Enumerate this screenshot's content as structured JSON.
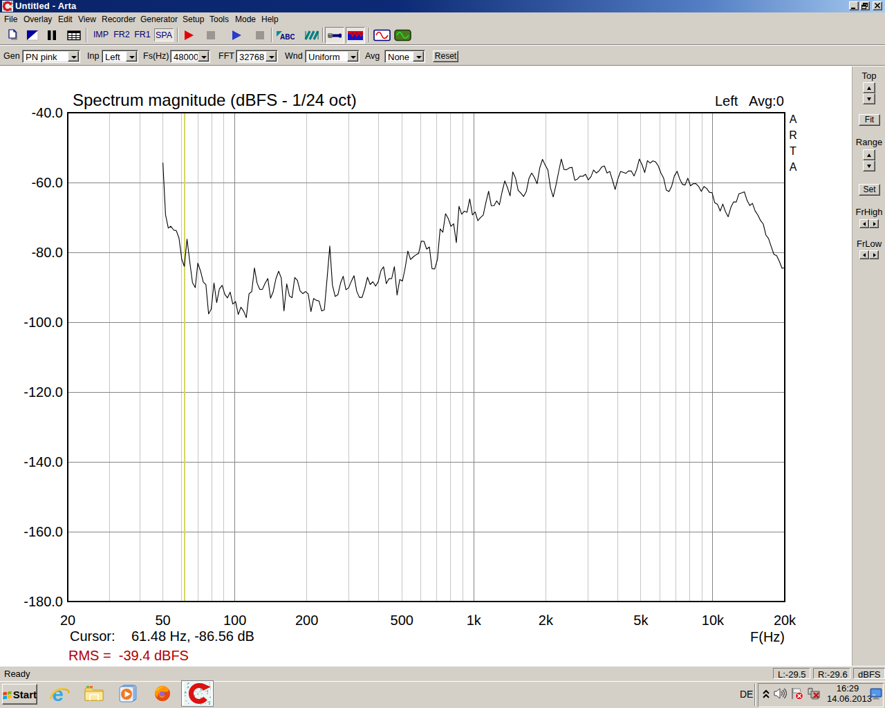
{
  "window": {
    "title": "Untitled - Arta"
  },
  "titlebar_buttons": {
    "minimize": "minimize",
    "restore": "restore",
    "close": "close"
  },
  "menu": {
    "items": [
      "File",
      "Overlay",
      "Edit",
      "View",
      "Recorder",
      "Generator",
      "Setup",
      "Tools",
      "Mode",
      "Help"
    ]
  },
  "toolbar": {
    "mode_buttons": [
      {
        "label": "IMP",
        "active": false
      },
      {
        "label": "FR2",
        "active": false
      },
      {
        "label": "FR1",
        "active": false
      },
      {
        "label": "SPA",
        "active": true
      }
    ]
  },
  "controls": {
    "gen": {
      "label": "Gen",
      "value": "PN pink"
    },
    "inp": {
      "label": "Inp",
      "value": "Left"
    },
    "fs": {
      "label": "Fs(Hz)",
      "value": "48000"
    },
    "fft": {
      "label": "FFT",
      "value": "32768"
    },
    "wnd": {
      "label": "Wnd",
      "value": "Uniform"
    },
    "avg": {
      "label": "Avg",
      "value": "None"
    },
    "reset_label": "Reset"
  },
  "side_panel": {
    "top_label": "Top",
    "fit_label": "Fit",
    "range_label": "Range",
    "set_label": "Set",
    "frhigh_label": "FrHigh",
    "frlow_label": "FrLow"
  },
  "chart_data": {
    "type": "line",
    "title": "Spectrum magnitude (dBFS - 1/24 oct)",
    "channel_label": "Left",
    "avg_label": "Avg:0",
    "watermark": "ARTA",
    "xlabel": "F(Hz)",
    "x_scale": "log",
    "xlim": [
      20,
      20000
    ],
    "ylim": [
      -180,
      -40
    ],
    "x_ticks": [
      {
        "value": 20,
        "label": "20"
      },
      {
        "value": 50,
        "label": "50"
      },
      {
        "value": 100,
        "label": "100"
      },
      {
        "value": 200,
        "label": "200"
      },
      {
        "value": 500,
        "label": "500"
      },
      {
        "value": 1000,
        "label": "1k"
      },
      {
        "value": 2000,
        "label": "2k"
      },
      {
        "value": 5000,
        "label": "5k"
      },
      {
        "value": 10000,
        "label": "10k"
      },
      {
        "value": 20000,
        "label": "20k"
      }
    ],
    "y_ticks": [
      {
        "value": -40,
        "label": "-40.0"
      },
      {
        "value": -60,
        "label": "-60.0"
      },
      {
        "value": -80,
        "label": "-80.0"
      },
      {
        "value": -100,
        "label": "-100.0"
      },
      {
        "value": -120,
        "label": "-120.0"
      },
      {
        "value": -140,
        "label": "-140.0"
      },
      {
        "value": -160,
        "label": "-160.0"
      },
      {
        "value": -180,
        "label": "-180.0"
      }
    ],
    "grid": {
      "minor_color": "#c6c6c6",
      "major_color": "#848484",
      "decades": [
        100,
        1000,
        10000
      ]
    },
    "cursor": {
      "freq_hz": 61.48,
      "db": -86.56,
      "label": "Cursor:",
      "value": "61.48 Hz, -86.56 dB",
      "color": "#d6d65e"
    },
    "rms_label": "RMS =  -39.4 dBFS",
    "rms_color": "#b00000",
    "series": [
      {
        "name": "Left",
        "color": "#000000",
        "points": [
          [
            50.0,
            -54.3
          ],
          [
            51.3,
            -69.18
          ],
          [
            52.7,
            -73.05
          ],
          [
            54.0,
            -72.52
          ],
          [
            55.5,
            -73.62
          ],
          [
            56.9,
            -73.79
          ],
          [
            58.4,
            -75.94
          ],
          [
            60.0,
            -81.99
          ],
          [
            61.5,
            -84.0
          ],
          [
            63.1,
            -76.2
          ],
          [
            64.8,
            -82.74
          ],
          [
            66.5,
            -88.67
          ],
          [
            68.3,
            -90.09
          ],
          [
            70.0,
            -83.06
          ],
          [
            71.9,
            -85.39
          ],
          [
            73.8,
            -88.5
          ],
          [
            75.7,
            -89.24
          ],
          [
            77.7,
            -97.6
          ],
          [
            79.7,
            -96.26
          ],
          [
            81.8,
            -88.76
          ],
          [
            84.0,
            -94.39
          ],
          [
            86.2,
            -90.46
          ],
          [
            88.5,
            -89.44
          ],
          [
            90.8,
            -92.01
          ],
          [
            93.2,
            -93.02
          ],
          [
            95.6,
            -91.36
          ],
          [
            98.1,
            -94.82
          ],
          [
            100.7,
            -94.09
          ],
          [
            103.4,
            -97.8
          ],
          [
            106.1,
            -95.7
          ],
          [
            108.9,
            -96.86
          ],
          [
            111.7,
            -98.7
          ],
          [
            114.7,
            -91.87
          ],
          [
            117.7,
            -91.22
          ],
          [
            120.8,
            -84.48
          ],
          [
            123.9,
            -88.8
          ],
          [
            127.2,
            -90.59
          ],
          [
            130.5,
            -90.57
          ],
          [
            134.0,
            -88.82
          ],
          [
            137.5,
            -87.5
          ],
          [
            141.1,
            -93.13
          ],
          [
            144.8,
            -91.22
          ],
          [
            148.6,
            -87.52
          ],
          [
            152.5,
            -85.38
          ],
          [
            156.5,
            -87.35
          ],
          [
            160.6,
            -96.8
          ],
          [
            164.9,
            -89.02
          ],
          [
            169.2,
            -92.48
          ],
          [
            173.6,
            -92.99
          ],
          [
            178.2,
            -87.18
          ],
          [
            182.9,
            -88.05
          ],
          [
            187.7,
            -91.04
          ],
          [
            192.6,
            -91.82
          ],
          [
            197.7,
            -91.21
          ],
          [
            202.9,
            -91.9
          ],
          [
            208.2,
            -96.97
          ],
          [
            213.7,
            -93.22
          ],
          [
            219.3,
            -93.74
          ],
          [
            225.1,
            -93.92
          ],
          [
            231.0,
            -96.8
          ],
          [
            237.0,
            -96.44
          ],
          [
            243.3,
            -87.41
          ],
          [
            249.7,
            -78.2
          ],
          [
            256.2,
            -89.39
          ],
          [
            263.0,
            -92.64
          ],
          [
            269.9,
            -92.13
          ],
          [
            277.0,
            -88.78
          ],
          [
            284.2,
            -86.86
          ],
          [
            291.7,
            -90.7
          ],
          [
            299.4,
            -90.18
          ],
          [
            307.2,
            -88.29
          ],
          [
            315.3,
            -86.68
          ],
          [
            323.6,
            -91.1
          ],
          [
            332.1,
            -92.9
          ],
          [
            340.8,
            -92.89
          ],
          [
            349.8,
            -90.4
          ],
          [
            359.0,
            -87.12
          ],
          [
            368.4,
            -89.21
          ],
          [
            378.1,
            -88.42
          ],
          [
            388.0,
            -89.67
          ],
          [
            398.2,
            -88.44
          ],
          [
            408.7,
            -85.21
          ],
          [
            419.4,
            -84.13
          ],
          [
            430.4,
            -88.95
          ],
          [
            441.7,
            -87.55
          ],
          [
            453.4,
            -87.52
          ],
          [
            465.3,
            -84.1
          ],
          [
            477.5,
            -92.22
          ],
          [
            490.0,
            -87.77
          ],
          [
            502.9,
            -88.21
          ],
          [
            516.1,
            -84.45
          ],
          [
            529.7,
            -79.62
          ],
          [
            543.6,
            -82.04
          ],
          [
            557.9,
            -81.29
          ],
          [
            572.6,
            -80.72
          ],
          [
            587.6,
            -80.28
          ],
          [
            603.0,
            -76.78
          ],
          [
            618.9,
            -76.84
          ],
          [
            635.1,
            -79.05
          ],
          [
            651.8,
            -78.48
          ],
          [
            669.0,
            -84.71
          ],
          [
            686.5,
            -84.74
          ],
          [
            704.6,
            -81.98
          ],
          [
            723.1,
            -73.28
          ],
          [
            742.1,
            -74.23
          ],
          [
            761.6,
            -68.94
          ],
          [
            781.6,
            -70.31
          ],
          [
            802.1,
            -72.54
          ],
          [
            823.2,
            -71.8
          ],
          [
            844.9,
            -77.23
          ],
          [
            867.1,
            -66.8
          ],
          [
            889.8,
            -69.06
          ],
          [
            913.2,
            -68.2
          ],
          [
            937.2,
            -68.5
          ],
          [
            961.8,
            -64.69
          ],
          [
            987.1,
            -69.29
          ],
          [
            1013.1,
            -68.42
          ],
          [
            1039.7,
            -70.93
          ],
          [
            1067.0,
            -70.02
          ],
          [
            1095.0,
            -69.32
          ],
          [
            1123.8,
            -65.69
          ],
          [
            1153.3,
            -62.49
          ],
          [
            1183.6,
            -66.67
          ],
          [
            1214.7,
            -66.64
          ],
          [
            1246.7,
            -65.27
          ],
          [
            1279.4,
            -66.39
          ],
          [
            1313.0,
            -62.67
          ],
          [
            1347.5,
            -59.53
          ],
          [
            1382.9,
            -61.43
          ],
          [
            1419.3,
            -63.83
          ],
          [
            1456.6,
            -56.95
          ],
          [
            1494.8,
            -58.7
          ],
          [
            1534.1,
            -62.24
          ],
          [
            1574.4,
            -63.04
          ],
          [
            1615.8,
            -64.0
          ],
          [
            1658.3,
            -62.59
          ],
          [
            1701.8,
            -58.79
          ],
          [
            1746.6,
            -57.26
          ],
          [
            1792.5,
            -58.56
          ],
          [
            1839.6,
            -60.36
          ],
          [
            1887.9,
            -55.77
          ],
          [
            1937.5,
            -53.36
          ],
          [
            1988.4,
            -55.0
          ],
          [
            2040.7,
            -56.38
          ],
          [
            2094.3,
            -61.57
          ],
          [
            2149.3,
            -64.12
          ],
          [
            2205.8,
            -60.86
          ],
          [
            2263.7,
            -57.03
          ],
          [
            2323.2,
            -53.26
          ],
          [
            2384.3,
            -56.27
          ],
          [
            2446.9,
            -56.31
          ],
          [
            2511.2,
            -55.8
          ],
          [
            2577.2,
            -55.67
          ],
          [
            2644.9,
            -59.34
          ],
          [
            2714.4,
            -58.99
          ],
          [
            2785.7,
            -58.15
          ],
          [
            2858.9,
            -58.22
          ],
          [
            2934.1,
            -57.62
          ],
          [
            3011.2,
            -59.25
          ],
          [
            3090.3,
            -58.33
          ],
          [
            3171.5,
            -56.41
          ],
          [
            3254.8,
            -57.26
          ],
          [
            3340.3,
            -56.69
          ],
          [
            3428.1,
            -55.57
          ],
          [
            3518.2,
            -55.25
          ],
          [
            3610.6,
            -57.28
          ],
          [
            3705.5,
            -56.82
          ],
          [
            3802.9,
            -59.31
          ],
          [
            3902.8,
            -61.98
          ],
          [
            4005.4,
            -58.99
          ],
          [
            4110.6,
            -56.84
          ],
          [
            4218.6,
            -57.08
          ],
          [
            4329.5,
            -57.36
          ],
          [
            4443.2,
            -56.67
          ],
          [
            4560.0,
            -56.71
          ],
          [
            4679.8,
            -58.14
          ],
          [
            4802.8,
            -56.27
          ],
          [
            4929.0,
            -53.28
          ],
          [
            5058.5,
            -54.91
          ],
          [
            5191.4,
            -57.12
          ],
          [
            5327.8,
            -53.75
          ],
          [
            5467.8,
            -54.44
          ],
          [
            5611.5,
            -53.8
          ],
          [
            5758.9,
            -54.07
          ],
          [
            5910.3,
            -55.19
          ],
          [
            6065.6,
            -57.27
          ],
          [
            6224.9,
            -58.73
          ],
          [
            6388.5,
            -62.18
          ],
          [
            6556.4,
            -62.6
          ],
          [
            6728.7,
            -61.03
          ],
          [
            6905.5,
            -58.09
          ],
          [
            7086.9,
            -56.78
          ],
          [
            7273.1,
            -59.0
          ],
          [
            7464.2,
            -60.52
          ],
          [
            7660.4,
            -60.72
          ],
          [
            7861.7,
            -58.76
          ],
          [
            8068.2,
            -60.94
          ],
          [
            8280.2,
            -60.36
          ],
          [
            8497.8,
            -60.31
          ],
          [
            8721.1,
            -61.11
          ],
          [
            8950.3,
            -62.53
          ],
          [
            9185.4,
            -61.15
          ],
          [
            9426.8,
            -61.7
          ],
          [
            9674.5,
            -62.79
          ],
          [
            9928.7,
            -62.91
          ],
          [
            10189.6,
            -65.81
          ],
          [
            10457.4,
            -66.22
          ],
          [
            10732.1,
            -68.18
          ],
          [
            11014.1,
            -66.16
          ],
          [
            11303.5,
            -68.36
          ],
          [
            11600.6,
            -69.78
          ],
          [
            11905.4,
            -67.08
          ],
          [
            12218.2,
            -65.57
          ],
          [
            12539.3,
            -65.57
          ],
          [
            12868.8,
            -63.2
          ],
          [
            13206.9,
            -62.95
          ],
          [
            13553.9,
            -62.68
          ],
          [
            13910.1,
            -65.11
          ],
          [
            14275.6,
            -66.6
          ],
          [
            14650.7,
            -65.96
          ],
          [
            15035.7,
            -68.14
          ],
          [
            15430.7,
            -69.3
          ],
          [
            15836.2,
            -70.88
          ],
          [
            16252.3,
            -71.89
          ],
          [
            16679.4,
            -74.99
          ],
          [
            17117.6,
            -76.06
          ],
          [
            17567.4,
            -78.38
          ],
          [
            18029.0,
            -80.6
          ],
          [
            18502.8,
            -80.93
          ],
          [
            18989.0,
            -82.58
          ],
          [
            19487.9,
            -84.56
          ],
          [
            20000.0,
            -84.4
          ]
        ]
      }
    ]
  },
  "status_bar": {
    "ready": "Ready",
    "left_level": "L:-29.5",
    "right_level": "R:-29.6",
    "unit": "dBFS"
  },
  "taskbar": {
    "start_label": "Start",
    "tray": {
      "lang": "DE",
      "time": "16:29",
      "date": "14.06.2013"
    }
  }
}
